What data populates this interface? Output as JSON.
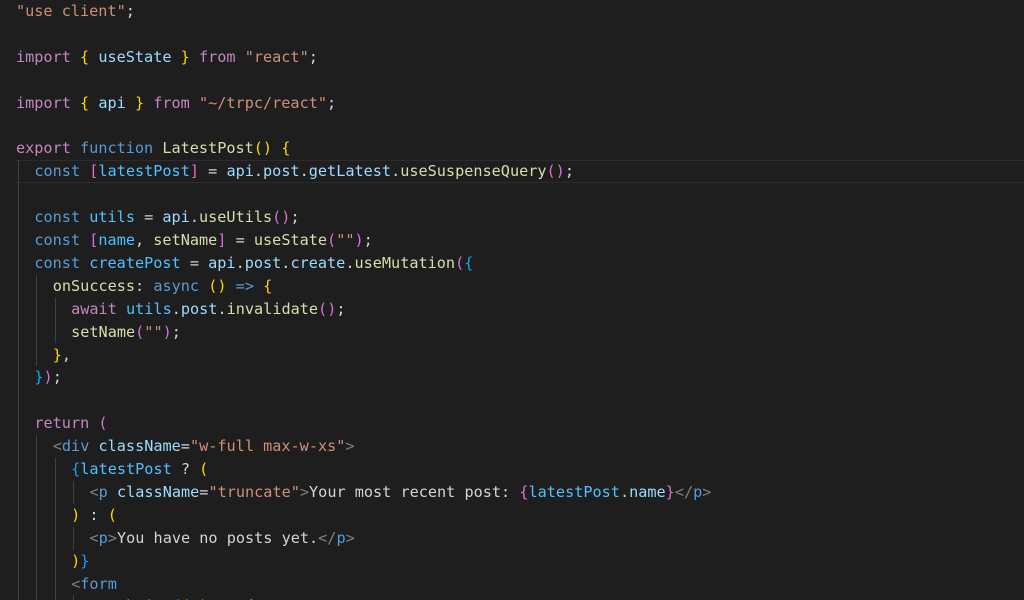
{
  "editor": {
    "language": "tsx",
    "colors": {
      "background": "#1e1e1e",
      "text": "#d4d4d4",
      "string": "#ce9178",
      "keyword": "#c586c0",
      "declaration": "#569cd6",
      "function": "#dcdcaa",
      "variable": "#9cdcfe",
      "constant": "#4fc1ff",
      "bracket_level_1": "#ffd700",
      "bracket_level_2": "#da70d6",
      "bracket_level_3": "#179fff",
      "tag": "#569cd6",
      "tag_punctuation": "#808080"
    },
    "current_line": 6,
    "lines": [
      {
        "indent": 0,
        "tokens": [
          {
            "t": "\"use client\"",
            "c": "str"
          },
          {
            "t": ";",
            "c": "text"
          }
        ]
      },
      {
        "indent": 0,
        "tokens": []
      },
      {
        "indent": 0,
        "tokens": [
          {
            "t": "import",
            "c": "kw"
          },
          {
            "t": " ",
            "c": "text"
          },
          {
            "t": "{",
            "c": "br1"
          },
          {
            "t": " ",
            "c": "text"
          },
          {
            "t": "useState",
            "c": "var"
          },
          {
            "t": " ",
            "c": "text"
          },
          {
            "t": "}",
            "c": "br1"
          },
          {
            "t": " ",
            "c": "text"
          },
          {
            "t": "from",
            "c": "kw"
          },
          {
            "t": " ",
            "c": "text"
          },
          {
            "t": "\"react\"",
            "c": "str"
          },
          {
            "t": ";",
            "c": "text"
          }
        ]
      },
      {
        "indent": 0,
        "tokens": []
      },
      {
        "indent": 0,
        "tokens": [
          {
            "t": "import",
            "c": "kw"
          },
          {
            "t": " ",
            "c": "text"
          },
          {
            "t": "{",
            "c": "br1"
          },
          {
            "t": " ",
            "c": "text"
          },
          {
            "t": "api",
            "c": "var"
          },
          {
            "t": " ",
            "c": "text"
          },
          {
            "t": "}",
            "c": "br1"
          },
          {
            "t": " ",
            "c": "text"
          },
          {
            "t": "from",
            "c": "kw"
          },
          {
            "t": " ",
            "c": "text"
          },
          {
            "t": "\"~/trpc/react\"",
            "c": "str"
          },
          {
            "t": ";",
            "c": "text"
          }
        ]
      },
      {
        "indent": 0,
        "tokens": []
      },
      {
        "indent": 0,
        "tokens": [
          {
            "t": "export",
            "c": "kw"
          },
          {
            "t": " ",
            "c": "text"
          },
          {
            "t": "function",
            "c": "decl"
          },
          {
            "t": " ",
            "c": "text"
          },
          {
            "t": "LatestPost",
            "c": "fn"
          },
          {
            "t": "()",
            "c": "br1"
          },
          {
            "t": " ",
            "c": "text"
          },
          {
            "t": "{",
            "c": "br1"
          }
        ]
      },
      {
        "indent": 1,
        "tokens": [
          {
            "t": "const",
            "c": "decl"
          },
          {
            "t": " ",
            "c": "text"
          },
          {
            "t": "[",
            "c": "br2"
          },
          {
            "t": "latestPost",
            "c": "const"
          },
          {
            "t": "]",
            "c": "br2"
          },
          {
            "t": " = ",
            "c": "text"
          },
          {
            "t": "api",
            "c": "var"
          },
          {
            "t": ".",
            "c": "text"
          },
          {
            "t": "post",
            "c": "var"
          },
          {
            "t": ".",
            "c": "text"
          },
          {
            "t": "getLatest",
            "c": "var"
          },
          {
            "t": ".",
            "c": "text"
          },
          {
            "t": "useSuspenseQuery",
            "c": "fn"
          },
          {
            "t": "()",
            "c": "br2"
          },
          {
            "t": ";",
            "c": "text"
          }
        ]
      },
      {
        "indent": 1,
        "tokens": []
      },
      {
        "indent": 1,
        "tokens": [
          {
            "t": "const",
            "c": "decl"
          },
          {
            "t": " ",
            "c": "text"
          },
          {
            "t": "utils",
            "c": "const"
          },
          {
            "t": " = ",
            "c": "text"
          },
          {
            "t": "api",
            "c": "var"
          },
          {
            "t": ".",
            "c": "text"
          },
          {
            "t": "useUtils",
            "c": "fn"
          },
          {
            "t": "()",
            "c": "br2"
          },
          {
            "t": ";",
            "c": "text"
          }
        ]
      },
      {
        "indent": 1,
        "tokens": [
          {
            "t": "const",
            "c": "decl"
          },
          {
            "t": " ",
            "c": "text"
          },
          {
            "t": "[",
            "c": "br2"
          },
          {
            "t": "name",
            "c": "const"
          },
          {
            "t": ", ",
            "c": "text"
          },
          {
            "t": "setName",
            "c": "fn"
          },
          {
            "t": "]",
            "c": "br2"
          },
          {
            "t": " = ",
            "c": "text"
          },
          {
            "t": "useState",
            "c": "fn"
          },
          {
            "t": "(",
            "c": "br2"
          },
          {
            "t": "\"\"",
            "c": "str"
          },
          {
            "t": ")",
            "c": "br2"
          },
          {
            "t": ";",
            "c": "text"
          }
        ]
      },
      {
        "indent": 1,
        "tokens": [
          {
            "t": "const",
            "c": "decl"
          },
          {
            "t": " ",
            "c": "text"
          },
          {
            "t": "createPost",
            "c": "const"
          },
          {
            "t": " = ",
            "c": "text"
          },
          {
            "t": "api",
            "c": "var"
          },
          {
            "t": ".",
            "c": "text"
          },
          {
            "t": "post",
            "c": "var"
          },
          {
            "t": ".",
            "c": "text"
          },
          {
            "t": "create",
            "c": "var"
          },
          {
            "t": ".",
            "c": "text"
          },
          {
            "t": "useMutation",
            "c": "fn"
          },
          {
            "t": "(",
            "c": "br2"
          },
          {
            "t": "{",
            "c": "br3"
          }
        ]
      },
      {
        "indent": 2,
        "tokens": [
          {
            "t": "onSuccess",
            "c": "fn"
          },
          {
            "t": ": ",
            "c": "text"
          },
          {
            "t": "async",
            "c": "decl"
          },
          {
            "t": " ",
            "c": "text"
          },
          {
            "t": "()",
            "c": "br1"
          },
          {
            "t": " ",
            "c": "text"
          },
          {
            "t": "=>",
            "c": "decl"
          },
          {
            "t": " ",
            "c": "text"
          },
          {
            "t": "{",
            "c": "br1"
          }
        ]
      },
      {
        "indent": 3,
        "tokens": [
          {
            "t": "await",
            "c": "kw"
          },
          {
            "t": " ",
            "c": "text"
          },
          {
            "t": "utils",
            "c": "const"
          },
          {
            "t": ".",
            "c": "text"
          },
          {
            "t": "post",
            "c": "var"
          },
          {
            "t": ".",
            "c": "text"
          },
          {
            "t": "invalidate",
            "c": "fn"
          },
          {
            "t": "()",
            "c": "br2"
          },
          {
            "t": ";",
            "c": "text"
          }
        ]
      },
      {
        "indent": 3,
        "tokens": [
          {
            "t": "setName",
            "c": "fn"
          },
          {
            "t": "(",
            "c": "br2"
          },
          {
            "t": "\"\"",
            "c": "str"
          },
          {
            "t": ")",
            "c": "br2"
          },
          {
            "t": ";",
            "c": "text"
          }
        ]
      },
      {
        "indent": 2,
        "tokens": [
          {
            "t": "}",
            "c": "br1"
          },
          {
            "t": ",",
            "c": "text"
          }
        ]
      },
      {
        "indent": 1,
        "tokens": [
          {
            "t": "}",
            "c": "br3"
          },
          {
            "t": ")",
            "c": "br2"
          },
          {
            "t": ";",
            "c": "text"
          }
        ]
      },
      {
        "indent": 1,
        "tokens": []
      },
      {
        "indent": 1,
        "tokens": [
          {
            "t": "return",
            "c": "kw"
          },
          {
            "t": " ",
            "c": "text"
          },
          {
            "t": "(",
            "c": "br2"
          }
        ]
      },
      {
        "indent": 2,
        "tokens": [
          {
            "t": "<",
            "c": "punct"
          },
          {
            "t": "div",
            "c": "tag"
          },
          {
            "t": " ",
            "c": "text"
          },
          {
            "t": "className",
            "c": "var"
          },
          {
            "t": "=",
            "c": "text"
          },
          {
            "t": "\"w-full max-w-xs\"",
            "c": "str"
          },
          {
            "t": ">",
            "c": "punct"
          }
        ]
      },
      {
        "indent": 3,
        "tokens": [
          {
            "t": "{",
            "c": "br3"
          },
          {
            "t": "latestPost",
            "c": "const"
          },
          {
            "t": " ? ",
            "c": "text"
          },
          {
            "t": "(",
            "c": "br1"
          }
        ]
      },
      {
        "indent": 4,
        "tokens": [
          {
            "t": "<",
            "c": "punct"
          },
          {
            "t": "p",
            "c": "tag"
          },
          {
            "t": " ",
            "c": "text"
          },
          {
            "t": "className",
            "c": "var"
          },
          {
            "t": "=",
            "c": "text"
          },
          {
            "t": "\"truncate\"",
            "c": "str"
          },
          {
            "t": ">",
            "c": "punct"
          },
          {
            "t": "Your most recent post: ",
            "c": "text"
          },
          {
            "t": "{",
            "c": "br2"
          },
          {
            "t": "latestPost",
            "c": "const"
          },
          {
            "t": ".",
            "c": "text"
          },
          {
            "t": "name",
            "c": "var"
          },
          {
            "t": "}",
            "c": "br2"
          },
          {
            "t": "</",
            "c": "punct"
          },
          {
            "t": "p",
            "c": "tag"
          },
          {
            "t": ">",
            "c": "punct"
          }
        ]
      },
      {
        "indent": 3,
        "tokens": [
          {
            "t": ")",
            "c": "br1"
          },
          {
            "t": " : ",
            "c": "text"
          },
          {
            "t": "(",
            "c": "br1"
          }
        ]
      },
      {
        "indent": 4,
        "tokens": [
          {
            "t": "<",
            "c": "punct"
          },
          {
            "t": "p",
            "c": "tag"
          },
          {
            "t": ">",
            "c": "punct"
          },
          {
            "t": "You have no posts yet.",
            "c": "text"
          },
          {
            "t": "</",
            "c": "punct"
          },
          {
            "t": "p",
            "c": "tag"
          },
          {
            "t": ">",
            "c": "punct"
          }
        ]
      },
      {
        "indent": 3,
        "tokens": [
          {
            "t": ")",
            "c": "br1"
          },
          {
            "t": "}",
            "c": "br3"
          }
        ]
      },
      {
        "indent": 3,
        "tokens": [
          {
            "t": "<",
            "c": "punct"
          },
          {
            "t": "form",
            "c": "tag"
          }
        ]
      },
      {
        "indent": 4,
        "tokens": [
          {
            "t": "onSubmit",
            "c": "var"
          },
          {
            "t": "=",
            "c": "text"
          },
          {
            "t": "{",
            "c": "br3"
          },
          {
            "t": "(",
            "c": "br1"
          },
          {
            "t": "e",
            "c": "var"
          },
          {
            "t": ")",
            "c": "br1"
          },
          {
            "t": " ",
            "c": "text"
          },
          {
            "t": "=>",
            "c": "decl"
          },
          {
            "t": " ",
            "c": "text"
          },
          {
            "t": "{",
            "c": "br1"
          }
        ]
      }
    ]
  }
}
